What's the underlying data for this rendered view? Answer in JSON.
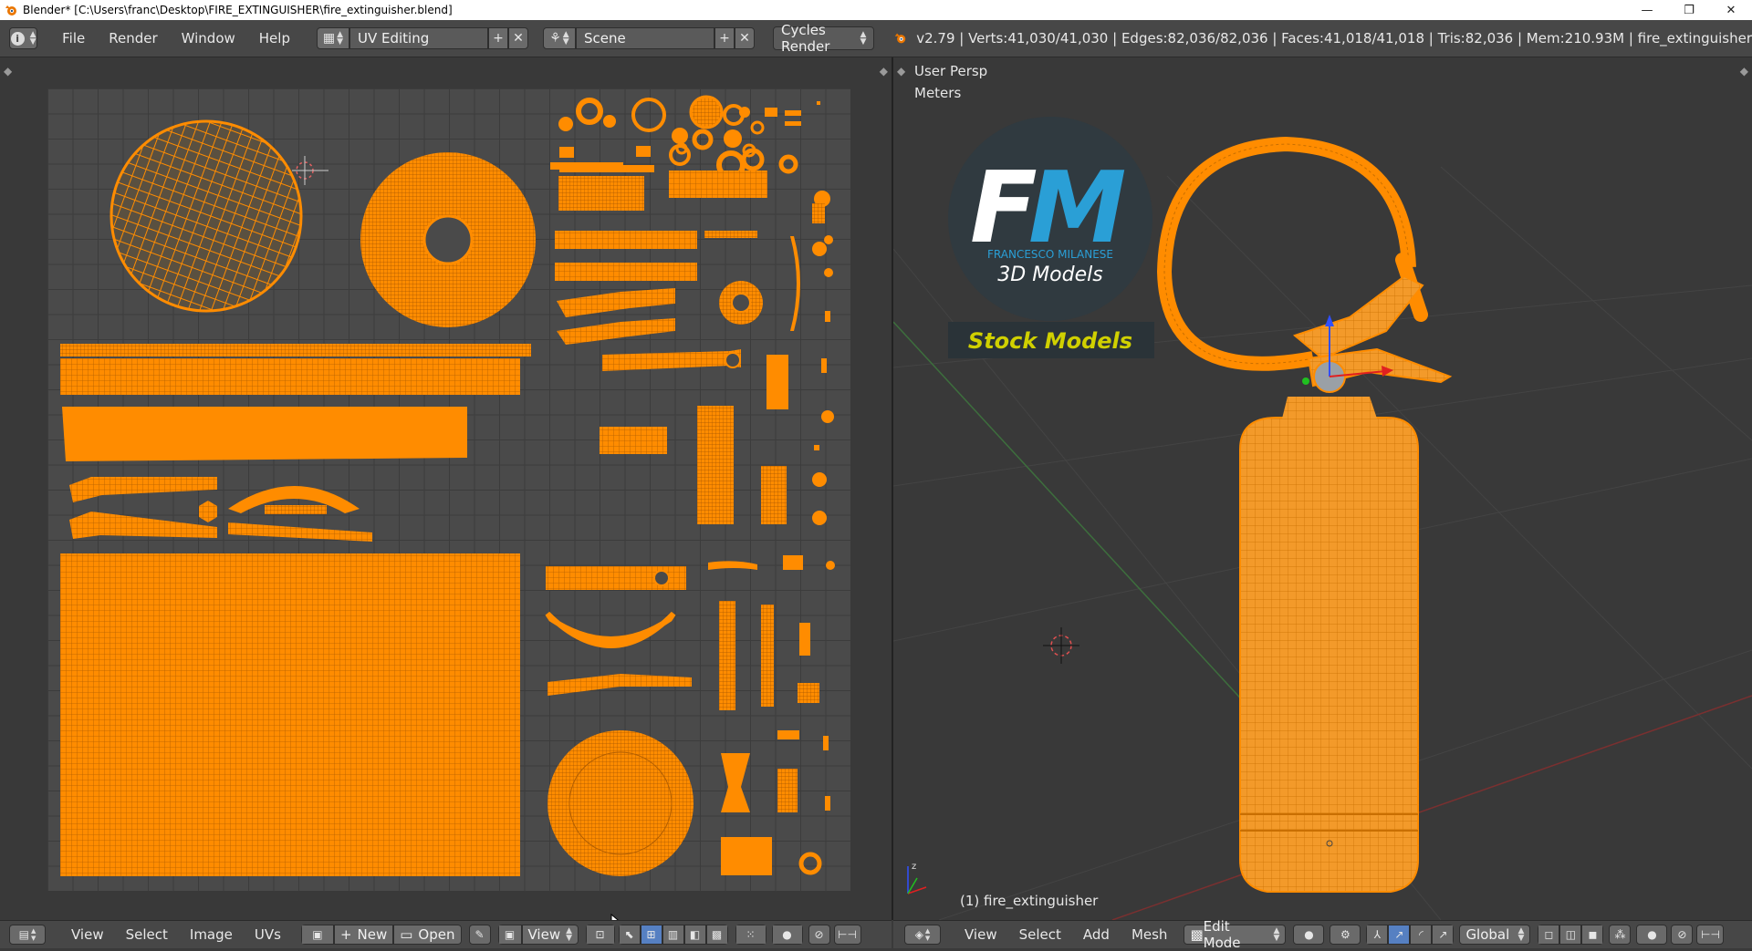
{
  "window": {
    "title": "Blender* [C:\\Users\\franc\\Desktop\\FIRE_EXTINGUISHER\\fire_extinguisher.blend]",
    "controls": [
      "—",
      "❐",
      "✕"
    ]
  },
  "topbar": {
    "menus": [
      "File",
      "Render",
      "Window",
      "Help"
    ],
    "screen_layout": "UV Editing",
    "scene": "Scene",
    "render_engine": "Cycles Render",
    "stats": "v2.79 | Verts:41,030/41,030 | Edges:82,036/82,036 | Faces:41,018/41,018 | Tris:82,036 | Mem:210.93M | fire_extinguisher"
  },
  "viewport": {
    "view_name": "User Persp",
    "units": "Meters",
    "object_label": "(1) fire_extinguisher",
    "watermark": {
      "logo_letters": "FM",
      "brand": "FRANCESCO MILANESE",
      "subtitle": "3D Models",
      "banner": "Stock Models"
    }
  },
  "uv_header": {
    "menus": [
      "View",
      "Select",
      "Image",
      "UVs"
    ],
    "new_label": "New",
    "open_label": "Open",
    "view_label": "View"
  },
  "view3d_header": {
    "menus": [
      "View",
      "Select",
      "Add",
      "Mesh"
    ],
    "mode": "Edit Mode",
    "orientation": "Global"
  },
  "colors": {
    "accent_orange": "#ff8c00",
    "header_bg": "#474747",
    "viewport_bg": "#393939",
    "uv_grid_bg": "#4a4a4a",
    "banner_text": "#d0d000",
    "logo_blue": "#2a9fd6"
  }
}
